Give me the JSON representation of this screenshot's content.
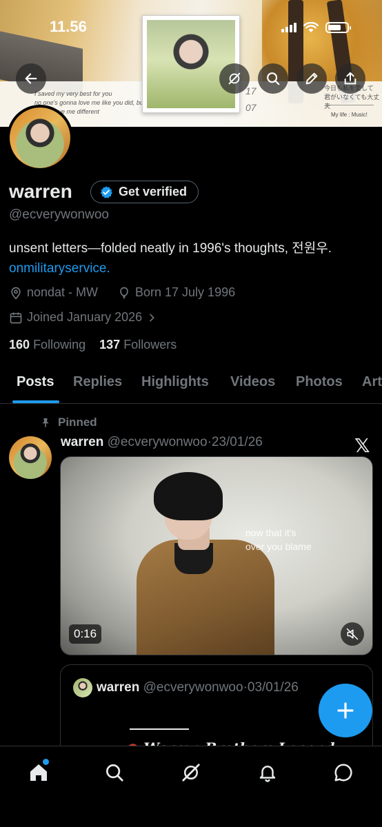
{
  "status_bar": {
    "time": "11.56"
  },
  "banner": {
    "letter_left_lines": [
      "I saved my very best for you",
      "no one's gonna love me like you did, but",
      "gonna love me different"
    ],
    "letter_right_lines": [
      "今日も私を愛して",
      "君がいなくても大丈夫"
    ],
    "my_life": "My life : Music!",
    "date_top": "17",
    "date_bottom": "07"
  },
  "profile": {
    "name": "warren",
    "verify_label": "Get verified",
    "handle": "@ecverywonwoo",
    "bio_text": "unsent letters—folded neatly in 1996's thoughts, 전원우. ",
    "bio_link": "onmilitaryservice.",
    "location": "nondat - MW",
    "birth": "Born 17 July 1996",
    "joined": "Joined January 2026",
    "following_count": "160",
    "following_label": "Following",
    "followers_count": "137",
    "followers_label": "Followers"
  },
  "tabs": [
    "Posts",
    "Replies",
    "Highlights",
    "Videos",
    "Photos",
    "Articles"
  ],
  "active_tab": "Posts",
  "pinned_label": "Pinned",
  "post": {
    "name": "warren",
    "handle": "@ecverywonwoo",
    "separator": "·",
    "date": "23/01/26",
    "video_caption_1": "now that it's",
    "video_caption_2": "over you blame",
    "video_duration": "0:16",
    "quoted": {
      "name": "warren",
      "handle": "@ecverywonwoo",
      "date": "03/01/26",
      "title": "Warren Brothers Legend"
    }
  },
  "colors": {
    "accent": "#1d9bf0",
    "muted": "#71767b",
    "text": "#e7e9ea",
    "divider": "#2f3336"
  },
  "icons": {
    "header": [
      "back-arrow-icon",
      "grok-icon",
      "search-icon",
      "edit-pencil-icon",
      "share-icon"
    ],
    "nav": [
      "home-icon",
      "search-icon",
      "grok-icon",
      "bell-icon",
      "messages-icon"
    ]
  }
}
